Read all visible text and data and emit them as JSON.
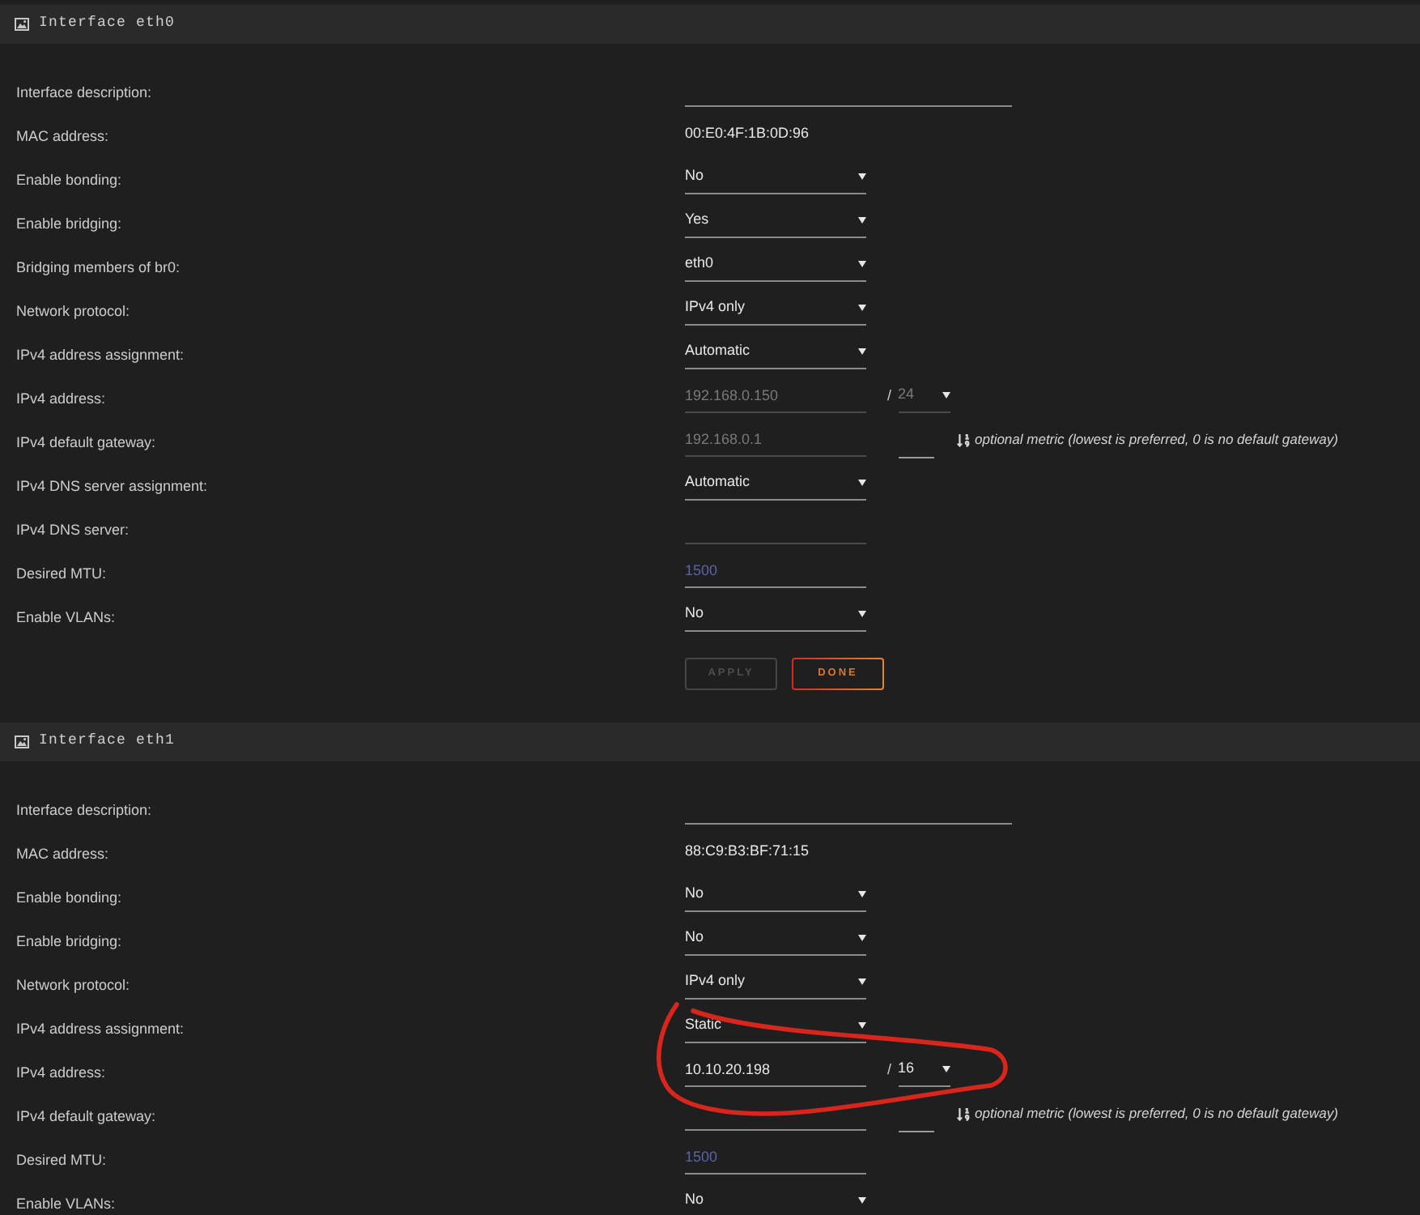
{
  "interfaces": [
    {
      "title": "Interface eth0",
      "fields": [
        {
          "kind": "description",
          "label": "Interface description:"
        },
        {
          "kind": "static",
          "label": "MAC address:",
          "value": "00:E0:4F:1B:0D:96"
        },
        {
          "kind": "select",
          "label": "Enable bonding:",
          "value": "No"
        },
        {
          "kind": "select",
          "label": "Enable bridging:",
          "value": "Yes"
        },
        {
          "kind": "select",
          "label": "Bridging members of br0:",
          "value": "eth0"
        },
        {
          "kind": "select",
          "label": "Network protocol:",
          "value": "IPv4 only"
        },
        {
          "kind": "select",
          "label": "IPv4 address assignment:",
          "value": "Automatic"
        },
        {
          "kind": "address",
          "label": "IPv4 address:",
          "value": "192.168.0.150",
          "separator": "/",
          "prefix": "24",
          "disabled": true
        },
        {
          "kind": "gateway",
          "label": "IPv4 default gateway:",
          "value": "192.168.0.1",
          "disabled": true,
          "hint": "optional metric (lowest is preferred, 0 is no default gateway)"
        },
        {
          "kind": "select",
          "label": "IPv4 DNS server assignment:",
          "value": "Automatic"
        },
        {
          "kind": "input",
          "label": "IPv4 DNS server:",
          "disabled": true
        },
        {
          "kind": "input",
          "label": "Desired MTU:",
          "placeholder": "1500",
          "disabled": false
        },
        {
          "kind": "select",
          "label": "Enable VLANs:",
          "value": "No"
        }
      ],
      "buttons": [
        {
          "label": "APPLY",
          "disabled": true
        },
        {
          "label": "DONE",
          "disabled": false
        }
      ]
    },
    {
      "title": "Interface eth1",
      "fields": [
        {
          "kind": "description",
          "label": "Interface description:"
        },
        {
          "kind": "static",
          "label": "MAC address:",
          "value": "88:C9:B3:BF:71:15"
        },
        {
          "kind": "select",
          "label": "Enable bonding:",
          "value": "No"
        },
        {
          "kind": "select",
          "label": "Enable bridging:",
          "value": "No"
        },
        {
          "kind": "select",
          "label": "Network protocol:",
          "value": "IPv4 only"
        },
        {
          "kind": "select",
          "label": "IPv4 address assignment:",
          "value": "Static"
        },
        {
          "kind": "address",
          "label": "IPv4 address:",
          "value": "10.10.20.198",
          "separator": "/",
          "prefix": "16",
          "disabled": false
        },
        {
          "kind": "gateway",
          "label": "IPv4 default gateway:",
          "disabled": false,
          "hint": "optional metric (lowest is preferred, 0 is no default gateway)"
        },
        {
          "kind": "input",
          "label": "Desired MTU:",
          "placeholder": "1500",
          "disabled": false
        },
        {
          "kind": "select",
          "label": "Enable VLANs:",
          "value": "No"
        }
      ]
    }
  ]
}
